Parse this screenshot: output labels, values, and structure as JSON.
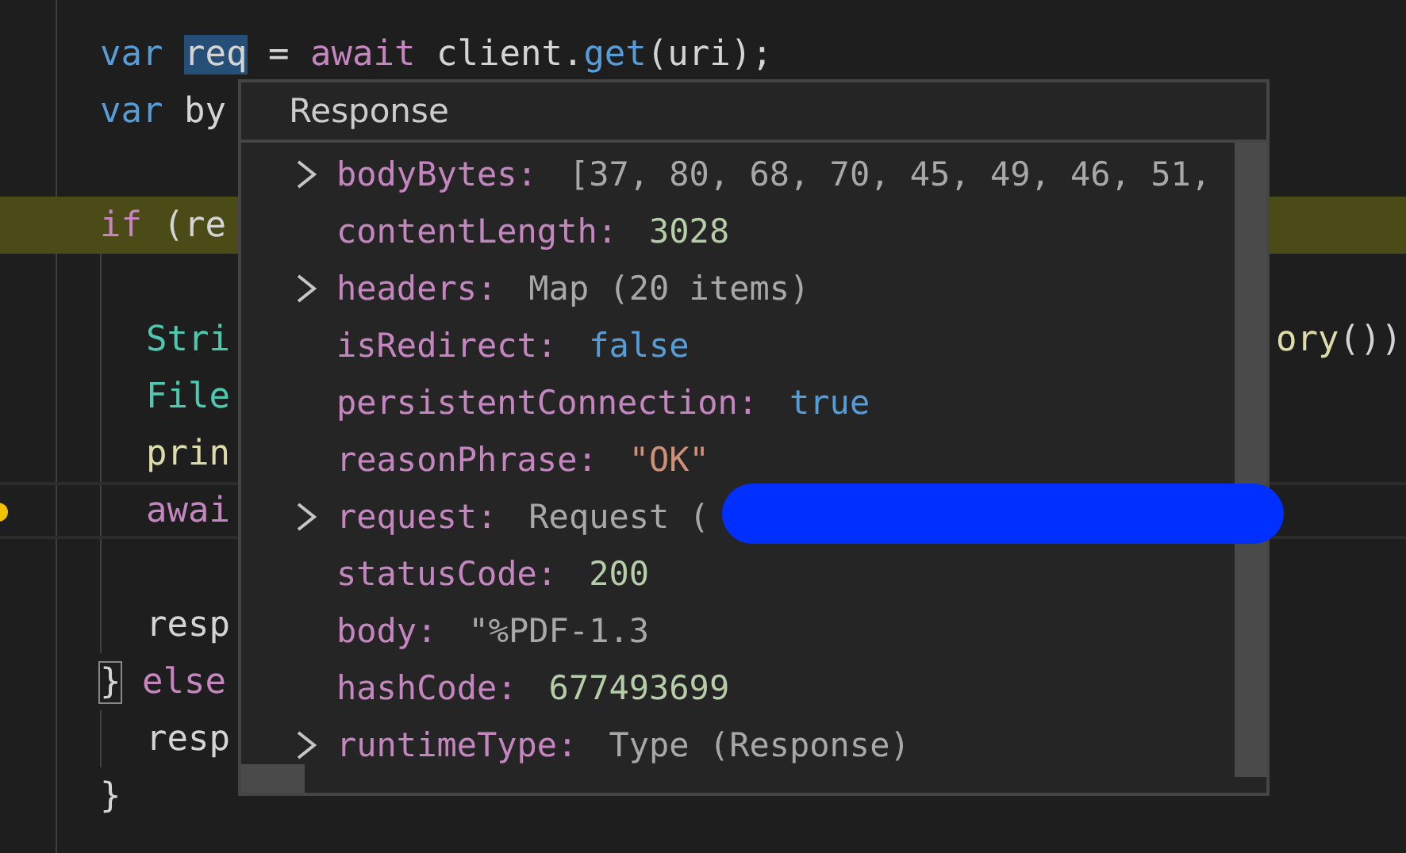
{
  "editor": {
    "lines": [
      {
        "left": [
          {
            "text": "var ",
            "kind": "keyword"
          },
          {
            "text": "req",
            "kind": "hovered"
          },
          {
            "text": " = "
          },
          {
            "text": "await",
            "kind": "control"
          },
          {
            "text": " client."
          },
          {
            "text": "get",
            "kind": "keyword"
          },
          {
            "text": "(uri);"
          }
        ],
        "indented": false,
        "highlighted": false,
        "current": false,
        "breakpoint": false
      },
      {
        "left": [
          {
            "text": "var",
            "kind": "keyword"
          },
          {
            "text": " by"
          }
        ],
        "indented": false,
        "highlighted": false,
        "current": false,
        "breakpoint": false
      },
      {
        "indented": false,
        "highlighted": false,
        "current": false,
        "breakpoint": false
      },
      {
        "left": [
          {
            "text": "if",
            "kind": "control"
          },
          {
            "text": " (re"
          }
        ],
        "indented": false,
        "highlighted": true,
        "current": false,
        "breakpoint": false
      },
      {
        "indented": true,
        "highlighted": false,
        "current": false,
        "breakpoint": false
      },
      {
        "left": [
          {
            "text": "Stri",
            "kind": "type"
          }
        ],
        "right": [
          {
            "text": "ory",
            "kind": "func"
          },
          {
            "text": "())"
          }
        ],
        "indented": true,
        "highlighted": false,
        "current": false,
        "breakpoint": false
      },
      {
        "left": [
          {
            "text": "File",
            "kind": "type"
          }
        ],
        "indented": true,
        "highlighted": false,
        "current": false,
        "breakpoint": false
      },
      {
        "left": [
          {
            "text": "prin",
            "kind": "func"
          }
        ],
        "indented": true,
        "highlighted": false,
        "current": false,
        "breakpoint": false
      },
      {
        "left": [
          {
            "text": "awai",
            "kind": "control"
          }
        ],
        "indented": true,
        "highlighted": false,
        "current": true,
        "breakpoint": true
      },
      {
        "indented": true,
        "highlighted": false,
        "current": false,
        "breakpoint": false
      },
      {
        "left": [
          {
            "text": "resp"
          }
        ],
        "indented": true,
        "highlighted": false,
        "current": false,
        "breakpoint": false
      },
      {
        "left": [
          {
            "text": "}",
            "kind": "bracket"
          },
          {
            "text": " else",
            "kind": "control"
          }
        ],
        "indented": false,
        "highlighted": false,
        "current": false,
        "breakpoint": false
      },
      {
        "left": [
          {
            "text": "resp"
          }
        ],
        "indented": true,
        "highlighted": false,
        "current": false,
        "breakpoint": false
      },
      {
        "left": [
          {
            "text": "}"
          }
        ],
        "indented": false,
        "highlighted": false,
        "current": false,
        "breakpoint": false
      }
    ]
  },
  "popup": {
    "title": "Response",
    "rows": [
      {
        "key": "bodyBytes:",
        "value": "[37, 80, 68, 70, 45, 49, 46, 51,",
        "kind": "preview",
        "expandable": true
      },
      {
        "key": "contentLength:",
        "value": "3028",
        "kind": "number",
        "expandable": false
      },
      {
        "key": "headers:",
        "value": "Map (20 items)",
        "kind": "preview",
        "expandable": true
      },
      {
        "key": "isRedirect:",
        "value": "false",
        "kind": "boolean",
        "expandable": false
      },
      {
        "key": "persistentConnection:",
        "value": "true",
        "kind": "boolean",
        "expandable": false
      },
      {
        "key": "reasonPhrase:",
        "value": "\"OK\"",
        "kind": "string",
        "expandable": false
      },
      {
        "key": "request:",
        "value": "Request (",
        "kind": "preview",
        "expandable": true,
        "redacted": true
      },
      {
        "key": "statusCode:",
        "value": "200",
        "kind": "number",
        "expandable": false
      },
      {
        "key": "body:",
        "value": "\"%PDF-1.3",
        "kind": "preview",
        "expandable": false
      },
      {
        "key": "hashCode:",
        "value": "677493699",
        "kind": "number",
        "expandable": false
      },
      {
        "key": "runtimeType:",
        "value": "Type (Response)",
        "kind": "preview",
        "expandable": true
      }
    ]
  }
}
